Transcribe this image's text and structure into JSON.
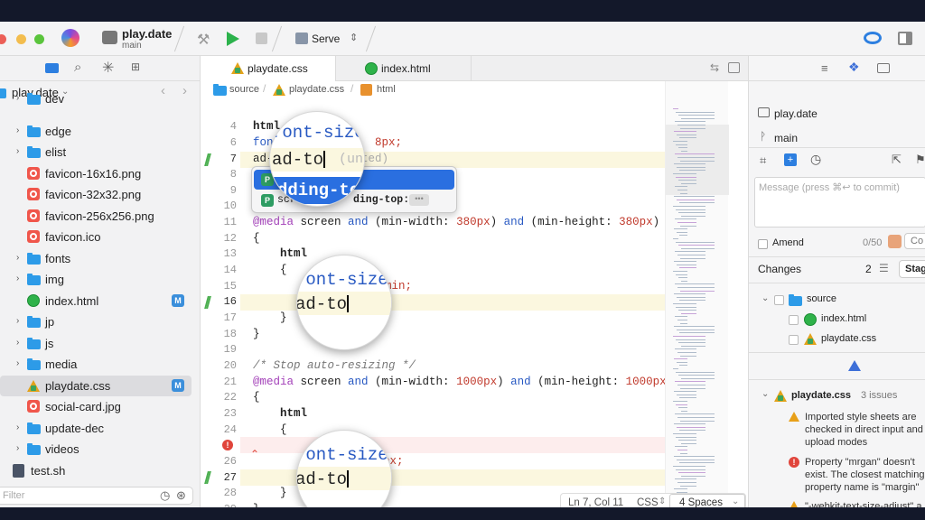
{
  "toolbar": {
    "project_name": "play.date",
    "branch": "main",
    "run_target": "Serve"
  },
  "sidebar": {
    "root": "play.date",
    "items": [
      {
        "label": "dev",
        "type": "folder"
      },
      {
        "label": "edge",
        "type": "folder"
      },
      {
        "label": "elist",
        "type": "folder"
      },
      {
        "label": "favicon-16x16.png",
        "type": "image"
      },
      {
        "label": "favicon-32x32.png",
        "type": "image"
      },
      {
        "label": "favicon-256x256.png",
        "type": "image"
      },
      {
        "label": "favicon.ico",
        "type": "image"
      },
      {
        "label": "fonts",
        "type": "folder"
      },
      {
        "label": "img",
        "type": "folder"
      },
      {
        "label": "index.html",
        "type": "html",
        "badge": "M"
      },
      {
        "label": "jp",
        "type": "folder"
      },
      {
        "label": "js",
        "type": "folder"
      },
      {
        "label": "media",
        "type": "folder"
      },
      {
        "label": "playdate.css",
        "type": "css",
        "badge": "M"
      },
      {
        "label": "social-card.jpg",
        "type": "image"
      },
      {
        "label": "update-dec",
        "type": "folder"
      },
      {
        "label": "videos",
        "type": "folder"
      },
      {
        "label": "test.sh",
        "type": "script"
      }
    ],
    "filter_placeholder": "Filter"
  },
  "editor": {
    "tabs": [
      {
        "label": "playdate.css",
        "active": true
      },
      {
        "label": "index.html",
        "active": false
      }
    ],
    "breadcrumb": [
      "source",
      "playdate.css",
      "html"
    ],
    "line_numbers": [
      "4",
      "6",
      "7",
      "8",
      "9",
      "10",
      "11",
      "12",
      "13",
      "14",
      "15",
      "16",
      "17",
      "18",
      "19",
      "20",
      "21",
      "22",
      "23",
      "24",
      "",
      "26",
      "27",
      "28",
      "29",
      "30"
    ],
    "lines": {
      "l4": "html",
      "l6a": "font-size:",
      "l6b": "8px;",
      "l7a": "ad-to",
      "l7b": "(uncommitted)",
      "l11a": "@media",
      "l11b": " screen ",
      "l11c": "and",
      "l11d": " (min-width: ",
      "l11e": "380px",
      "l11f": ") ",
      "l11g": "and",
      "l11h": " (min-height: ",
      "l11i": "380px",
      "l11j": ")",
      "l12": "{",
      "l13": "    html",
      "l14": "    {",
      "l15": "min;",
      "l17": "    }",
      "l18": "}",
      "l20": "/* Stop auto-resizing */",
      "l21a": "@media",
      "l21b": " screen ",
      "l21c": "and",
      "l21d": " (min-width: ",
      "l21e": "1000px",
      "l21f": ") ",
      "l21g": "and",
      "l21h": " (min-height: ",
      "l21i": "1000px",
      "l21j": ")",
      "l22": "{",
      "l23": "    html",
      "l24": "    {",
      "l25": "px;",
      "l28": "    }",
      "l29": "}"
    },
    "magnifier_1": {
      "line1": "font-size:",
      "line2": "ad-to",
      "ghost": "(un"
    },
    "magnifier_2": {
      "line1": "font-size:",
      "line2": "ad-to"
    },
    "magnifier_3": {
      "line1": "font-size:",
      "line2": "ad-to"
    },
    "autocomplete": [
      {
        "icon": "P",
        "text": "padding-top",
        "shown": "dding-to"
      },
      {
        "icon": "P",
        "text": "scroll-padding-top:",
        "shown_prefix": "scr",
        "shown_rest": "ding-top:"
      }
    ],
    "status": {
      "position": "Ln 7, Col 11",
      "language": "CSS",
      "indent": "4 Spaces"
    }
  },
  "right_panel": {
    "repo": "play.date",
    "branch": "main",
    "commit_placeholder": "Message (press ⌘↩ to commit)",
    "amend_label": "Amend",
    "char_count": "0/50",
    "commit_button": "Co",
    "changes_label": "Changes",
    "changes_count": "2",
    "stage_button": "Stag",
    "changed_files": {
      "folder": "source",
      "files": [
        "index.html",
        "playdate.css"
      ]
    },
    "issues": {
      "file": "playdate.css",
      "count": "3 issues",
      "items": [
        {
          "kind": "warning",
          "text": "Imported style sheets are checked in direct input and file upload modes"
        },
        {
          "kind": "error",
          "text": "Property \"mrgan\" doesn't exist. The closest matching property name is \"margin\""
        },
        {
          "kind": "warning",
          "text": "\"-webkit-text-size-adjust\" a vendor extension"
        }
      ]
    }
  }
}
